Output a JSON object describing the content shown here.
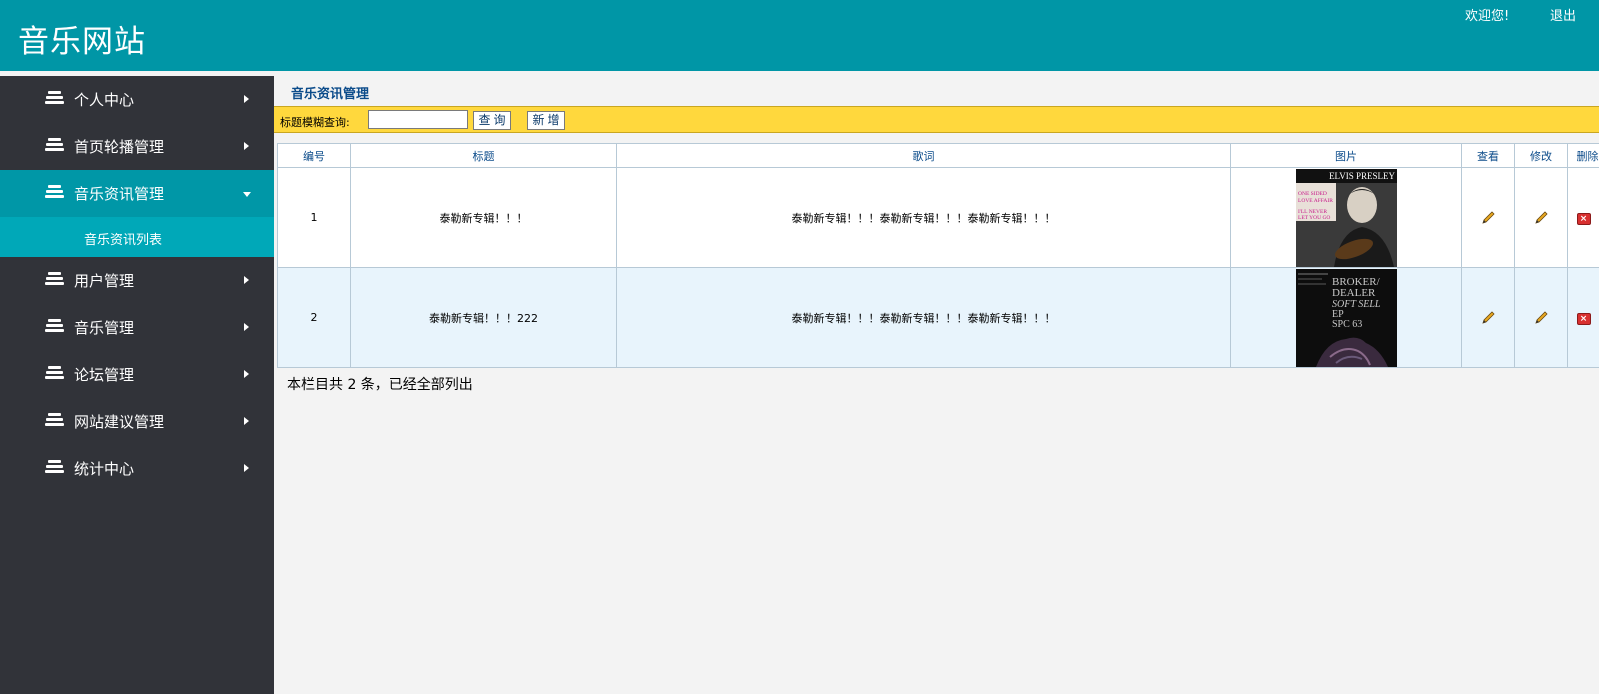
{
  "header": {
    "site_title": "音乐网站",
    "welcome": "欢迎您!",
    "logout": "退出"
  },
  "sidebar": {
    "items": [
      {
        "label": "个人中心"
      },
      {
        "label": "首页轮播管理"
      },
      {
        "label": "音乐资讯管理",
        "active": true
      },
      {
        "label": "用户管理"
      },
      {
        "label": "音乐管理"
      },
      {
        "label": "论坛管理"
      },
      {
        "label": "网站建议管理"
      },
      {
        "label": "统计中心"
      }
    ],
    "submenu": {
      "label": "音乐资讯列表"
    }
  },
  "main": {
    "title": "音乐资讯管理",
    "search": {
      "label": "标题模糊查询:",
      "value": "",
      "search_button": "查询",
      "add_button": "新增"
    },
    "table": {
      "columns": [
        "编号",
        "标题",
        "歌词",
        "图片",
        "查看",
        "修改",
        "删除"
      ],
      "rows": [
        {
          "id": "1",
          "title": "泰勒新专辑！！！",
          "lyrics": "泰勒新专辑！！！泰勒新专辑！！！泰勒新专辑！！！",
          "image_text": [
            "ELVIS PRESLEY",
            "ONE SIDED",
            "LOVE AFFAIR",
            "I'LL NEVER",
            "LET YOU GO"
          ]
        },
        {
          "id": "2",
          "title": "泰勒新专辑！！！222",
          "lyrics": "泰勒新专辑！！！泰勒新专辑！！！泰勒新专辑！！！",
          "image_text": [
            "BROKER/",
            "DEALER",
            "SOFT SELL",
            "EP",
            "SPC 63"
          ]
        }
      ]
    },
    "summary": "本栏目共 2 条，已经全部列出"
  },
  "colors": {
    "header_bg": "#0096a6",
    "sidebar_bg": "#313339",
    "active_bg": "#0097a7",
    "submenu_bg": "#00a8b8",
    "toolbar_bg": "#ffd83d",
    "title_color": "#0b4b8a"
  },
  "icons": [
    "layers-icon",
    "chevron-right-icon",
    "chevron-down-icon",
    "pencil-icon",
    "delete-icon"
  ]
}
